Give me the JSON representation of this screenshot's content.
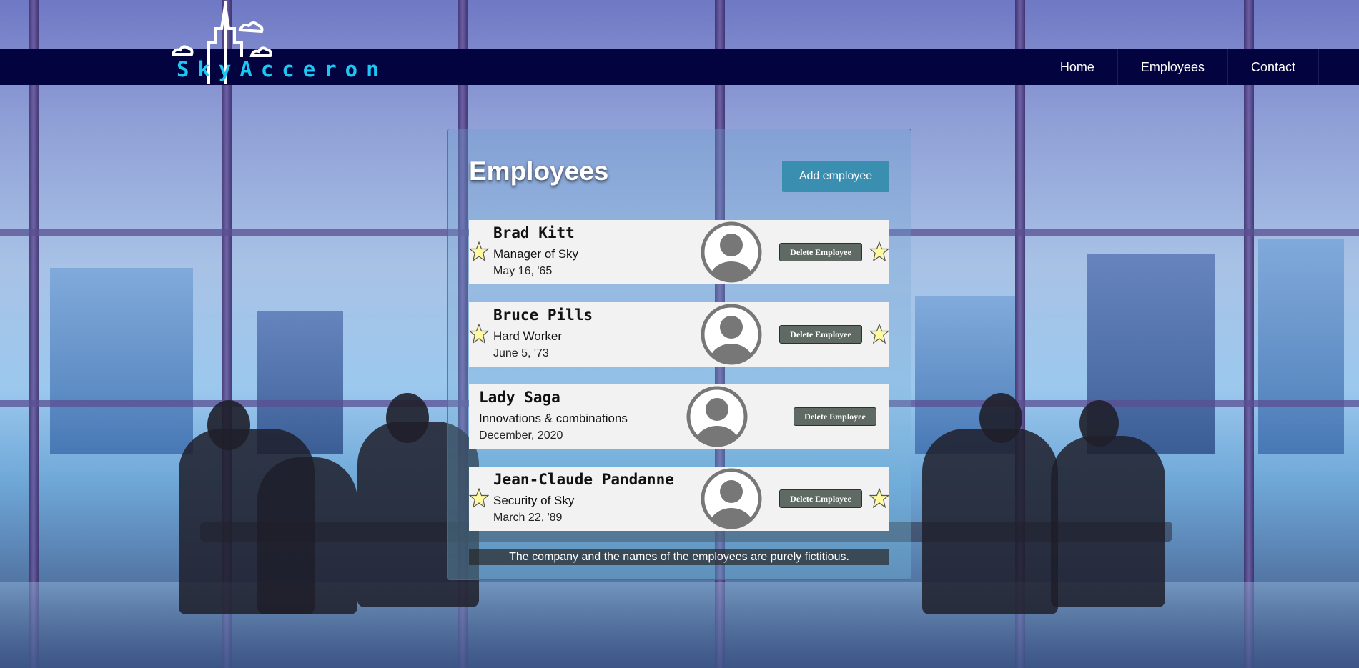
{
  "brand": {
    "name": "SkyAcceron"
  },
  "nav": {
    "items": [
      "Home",
      "Employees",
      "Contact"
    ]
  },
  "panel": {
    "title": "Employees",
    "add_label": "Add employee"
  },
  "employees": [
    {
      "name": "Brad Kitt",
      "role": "Manager of Sky",
      "date": "May 16, '65",
      "starred": true,
      "delete_label": "Delete Employee"
    },
    {
      "name": "Bruce Pills",
      "role": "Hard Worker",
      "date": "June 5, '73",
      "starred": true,
      "delete_label": "Delete Employee"
    },
    {
      "name": "Lady Saga",
      "role": "Innovations & combinations",
      "date": "December, 2020",
      "starred": false,
      "delete_label": "Delete Employee"
    },
    {
      "name": "Jean-Claude Pandanne",
      "role": "Security of Sky",
      "date": "March 22, '89",
      "starred": true,
      "delete_label": "Delete Employee"
    }
  ],
  "footer_note": "The company and the names of the employees are purely fictitious.",
  "colors": {
    "navbar": "#03033f",
    "accent": "#3a8fb0",
    "logo": "#1ec7f2",
    "card": "#f2f2f2",
    "delete_button": "#5f6a64"
  },
  "icons": {
    "avatar": "user-avatar-icon",
    "star": "star-icon",
    "skyline": "skyline-logo-icon"
  }
}
